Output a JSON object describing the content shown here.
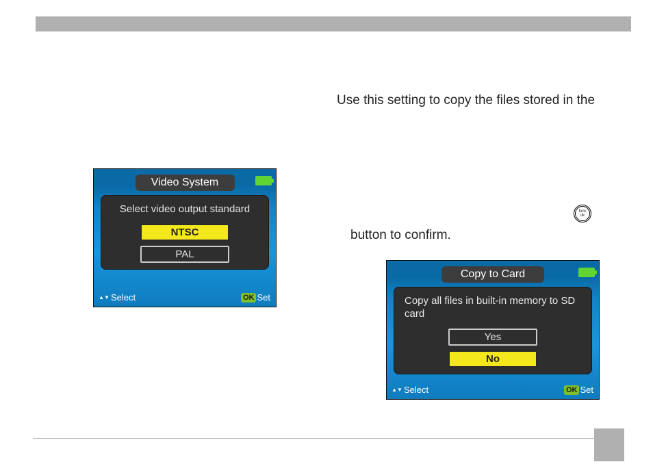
{
  "body": {
    "intro": "Use this setting to copy the files stored in the",
    "confirm_suffix": "button to confirm."
  },
  "func_ok": {
    "line1": "func",
    "line2": "ok"
  },
  "lcd_video": {
    "title": "Video System",
    "message": "Select video output standard",
    "options": [
      {
        "label": "NTSC",
        "selected": true
      },
      {
        "label": "PAL",
        "selected": false
      }
    ],
    "footer_select": "Select",
    "footer_ok": "OK",
    "footer_set": "Set"
  },
  "lcd_copy": {
    "title": "Copy to Card",
    "message": "Copy all files in built-in memory to SD card",
    "options": [
      {
        "label": "Yes",
        "selected": false
      },
      {
        "label": "No",
        "selected": true
      }
    ],
    "footer_select": "Select",
    "footer_ok": "OK",
    "footer_set": "Set"
  }
}
